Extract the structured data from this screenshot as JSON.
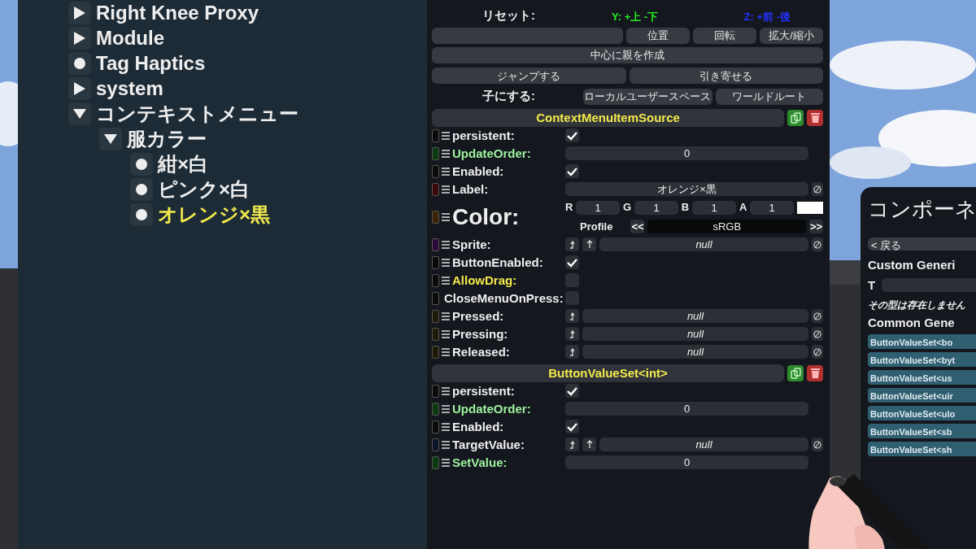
{
  "hierarchy": {
    "items": [
      {
        "label": "Right Knee Proxy",
        "kind": "branch",
        "expanded": false,
        "selected": false
      },
      {
        "label": "Module",
        "kind": "branch",
        "expanded": false,
        "selected": false
      },
      {
        "label": "Tag Haptics",
        "kind": "leaf",
        "selected": false
      },
      {
        "label": "system",
        "kind": "branch",
        "expanded": false,
        "selected": false
      },
      {
        "label": "コンテキストメニュー",
        "kind": "branch",
        "expanded": true,
        "selected": false,
        "children": [
          {
            "label": "服カラー",
            "kind": "branch",
            "expanded": true,
            "selected": false,
            "children": [
              {
                "label": "紺×白",
                "kind": "leaf",
                "selected": false
              },
              {
                "label": "ピンク×白",
                "kind": "leaf",
                "selected": false
              },
              {
                "label": "オレンジ×黒",
                "kind": "leaf",
                "selected": true
              }
            ]
          }
        ]
      }
    ]
  },
  "tools": {
    "axis_hints": [
      {
        "text": "Y: +上 -下",
        "color": "#22ee22"
      },
      {
        "text": "Z: +前 -後",
        "color": "#2233ff"
      }
    ],
    "reset_label": "リセット:",
    "reset_buttons": [
      "位置",
      "回転",
      "拡大/縮小"
    ],
    "parent_button": "中心に親を作成",
    "jump_button": "ジャンプする",
    "bring_button": "引き寄せる",
    "child_label": "子にする:",
    "child_buttons": [
      "ローカルユーザースペース",
      "ワールドルート"
    ]
  },
  "components": [
    {
      "title": "ContextMenuItemSource",
      "fields": [
        {
          "label": {
            "text": "persistent:",
            "color": "#eeeeee"
          },
          "kind": "checkbox",
          "checked": true,
          "color": "#0a0a0a"
        },
        {
          "label": {
            "text": "UpdateOrder:",
            "color": "#9ef29e"
          },
          "kind": "number",
          "value": "0",
          "color": "#0c3a10"
        },
        {
          "label": {
            "text": "Enabled:",
            "color": "#eeeeee"
          },
          "kind": "checkbox",
          "checked": true,
          "color": "#0a0a0a"
        },
        {
          "label": {
            "text": "Label:",
            "color": "#eeeeee"
          },
          "kind": "text",
          "value": "オレンジ×黒",
          "color": "#3a0a0a"
        },
        {
          "label": {
            "text": "Color:",
            "color": "#eeeeee"
          },
          "kind": "color",
          "channels": [
            {
              "label": "R",
              "value": "1"
            },
            {
              "label": "G",
              "value": "1"
            },
            {
              "label": "B",
              "value": "1"
            },
            {
              "label": "A",
              "value": "1"
            }
          ],
          "profile_label": "Profile",
          "profile": "sRGB",
          "prev": "<<",
          "next": ">>",
          "swatch": {
            "color": "#ffffff"
          },
          "color": "#3a2206"
        },
        {
          "label": {
            "text": "Sprite:",
            "color": "#eeeeee"
          },
          "kind": "asset",
          "value": "null",
          "color": "#2a0c3a"
        },
        {
          "label": {
            "text": "ButtonEnabled:",
            "color": "#eeeeee"
          },
          "kind": "checkbox",
          "checked": true,
          "color": "#0a0a0a"
        },
        {
          "label": {
            "text": "AllowDrag:",
            "color": "#f2ea4c"
          },
          "kind": "checkbox",
          "checked": false,
          "color": "#0a0a0a"
        },
        {
          "label": {
            "text": "CloseMenuOnPress:",
            "color": "#eeeeee"
          },
          "kind": "checkbox",
          "checked": false,
          "color": "#0a0a0a"
        },
        {
          "label": {
            "text": "Pressed:",
            "color": "#eeeeee"
          },
          "kind": "ref",
          "value": "null",
          "color": "#1e1a08"
        },
        {
          "label": {
            "text": "Pressing:",
            "color": "#eeeeee"
          },
          "kind": "ref",
          "value": "null",
          "color": "#1e1a08"
        },
        {
          "label": {
            "text": "Released:",
            "color": "#eeeeee"
          },
          "kind": "ref",
          "value": "null",
          "color": "#1e1a08"
        }
      ]
    },
    {
      "title": "ButtonValueSet<int>",
      "fields": [
        {
          "label": {
            "text": "persistent:",
            "color": "#eeeeee"
          },
          "kind": "checkbox",
          "checked": true,
          "color": "#0a0a0a"
        },
        {
          "label": {
            "text": "UpdateOrder:",
            "color": "#9ef29e"
          },
          "kind": "number",
          "value": "0",
          "color": "#0c3a10"
        },
        {
          "label": {
            "text": "Enabled:",
            "color": "#eeeeee"
          },
          "kind": "checkbox",
          "checked": true,
          "color": "#0a0a0a"
        },
        {
          "label": {
            "text": "TargetValue:",
            "color": "#eeeeee"
          },
          "kind": "asset",
          "value": "null",
          "color": "#0a1426"
        },
        {
          "label": {
            "text": "SetValue:",
            "color": "#9ef29e"
          },
          "kind": "number",
          "value": "0",
          "color": "#0c3a10"
        }
      ]
    }
  ],
  "component_browser": {
    "title": "コンポーネ",
    "back": "< 戻る",
    "custom_heading": "Custom Generi",
    "type_label": "T",
    "error": "その型は存在しません",
    "common_heading": "Common Gene",
    "items": [
      "ButtonValueSet<bo",
      "ButtonValueSet<byt",
      "ButtonValueSet<us",
      "ButtonValueSet<uir",
      "ButtonValueSet<ulo",
      "ButtonValueSet<sb",
      "ButtonValueSet<sh"
    ]
  }
}
